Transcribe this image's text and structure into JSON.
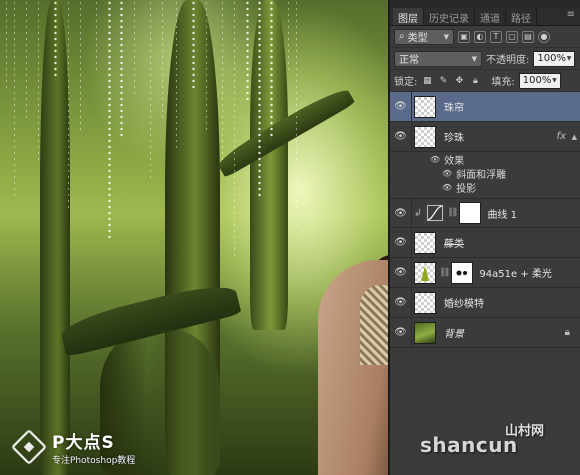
{
  "panel": {
    "tabs": [
      {
        "label": "图层",
        "active": true
      },
      {
        "label": "历史记录",
        "active": false
      },
      {
        "label": "通道",
        "active": false
      },
      {
        "label": "路径",
        "active": false
      }
    ],
    "menu_glyph": "≡",
    "filter": {
      "icon": "search-icon",
      "value": "类型"
    },
    "blend": {
      "mode": "正常",
      "opacity_label": "不透明度:",
      "opacity_value": "100%"
    },
    "lock": {
      "label": "锁定:",
      "fill_label": "填充:",
      "fill_value": "100%"
    }
  },
  "layers": [
    {
      "name": "珠帘",
      "type": "transparent",
      "selected": true
    },
    {
      "name": "珍珠",
      "type": "transparent",
      "fx": "fx",
      "effects_label": "效果",
      "effects": [
        "斜面和浮雕",
        "投影"
      ]
    },
    {
      "name": "曲线 1",
      "type": "curves"
    },
    {
      "name": "藤类",
      "type": "transparent",
      "strike": true
    },
    {
      "name": "94a51e + 柔光",
      "type": "fill-mask"
    },
    {
      "name": "婚纱模特",
      "type": "transparent"
    },
    {
      "name": "背景",
      "type": "forest",
      "locked": true,
      "italic": true
    }
  ],
  "branding": {
    "logo_title": "P大点S",
    "logo_subtitle": "专注Photoshop教程",
    "watermark": "shancun",
    "watermark_cn": "山村网"
  },
  "colors": {
    "panel_bg": "#3b3b3b",
    "selected_layer": "#5a6a8a",
    "fill_color": "#94a51e"
  }
}
